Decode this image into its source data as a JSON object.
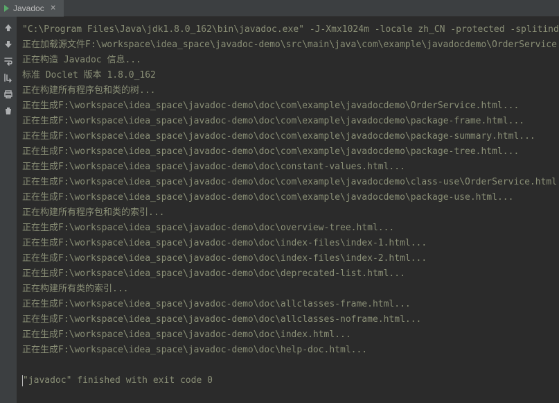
{
  "tab": {
    "label": "Javadoc",
    "close": "×"
  },
  "console": {
    "lines": [
      "\"C:\\Program Files\\Java\\jdk1.8.0_162\\bin\\javadoc.exe\" -J-Xmx1024m -locale zh_CN -protected -splitindex -use -au",
      "正在加载源文件F:\\workspace\\idea_space\\javadoc-demo\\src\\main\\java\\com\\example\\javadocdemo\\OrderService.java...",
      "正在构造 Javadoc 信息...",
      "标准 Doclet 版本 1.8.0_162",
      "正在构建所有程序包和类的树...",
      "正在生成F:\\workspace\\idea_space\\javadoc-demo\\doc\\com\\example\\javadocdemo\\OrderService.html...",
      "正在生成F:\\workspace\\idea_space\\javadoc-demo\\doc\\com\\example\\javadocdemo\\package-frame.html...",
      "正在生成F:\\workspace\\idea_space\\javadoc-demo\\doc\\com\\example\\javadocdemo\\package-summary.html...",
      "正在生成F:\\workspace\\idea_space\\javadoc-demo\\doc\\com\\example\\javadocdemo\\package-tree.html...",
      "正在生成F:\\workspace\\idea_space\\javadoc-demo\\doc\\constant-values.html...",
      "正在生成F:\\workspace\\idea_space\\javadoc-demo\\doc\\com\\example\\javadocdemo\\class-use\\OrderService.html...",
      "正在生成F:\\workspace\\idea_space\\javadoc-demo\\doc\\com\\example\\javadocdemo\\package-use.html...",
      "正在构建所有程序包和类的索引...",
      "正在生成F:\\workspace\\idea_space\\javadoc-demo\\doc\\overview-tree.html...",
      "正在生成F:\\workspace\\idea_space\\javadoc-demo\\doc\\index-files\\index-1.html...",
      "正在生成F:\\workspace\\idea_space\\javadoc-demo\\doc\\index-files\\index-2.html...",
      "正在生成F:\\workspace\\idea_space\\javadoc-demo\\doc\\deprecated-list.html...",
      "正在构建所有类的索引...",
      "正在生成F:\\workspace\\idea_space\\javadoc-demo\\doc\\allclasses-frame.html...",
      "正在生成F:\\workspace\\idea_space\\javadoc-demo\\doc\\allclasses-noframe.html...",
      "正在生成F:\\workspace\\idea_space\\javadoc-demo\\doc\\index.html...",
      "正在生成F:\\workspace\\idea_space\\javadoc-demo\\doc\\help-doc.html..."
    ],
    "final": "\"javadoc\" finished with exit code 0"
  }
}
